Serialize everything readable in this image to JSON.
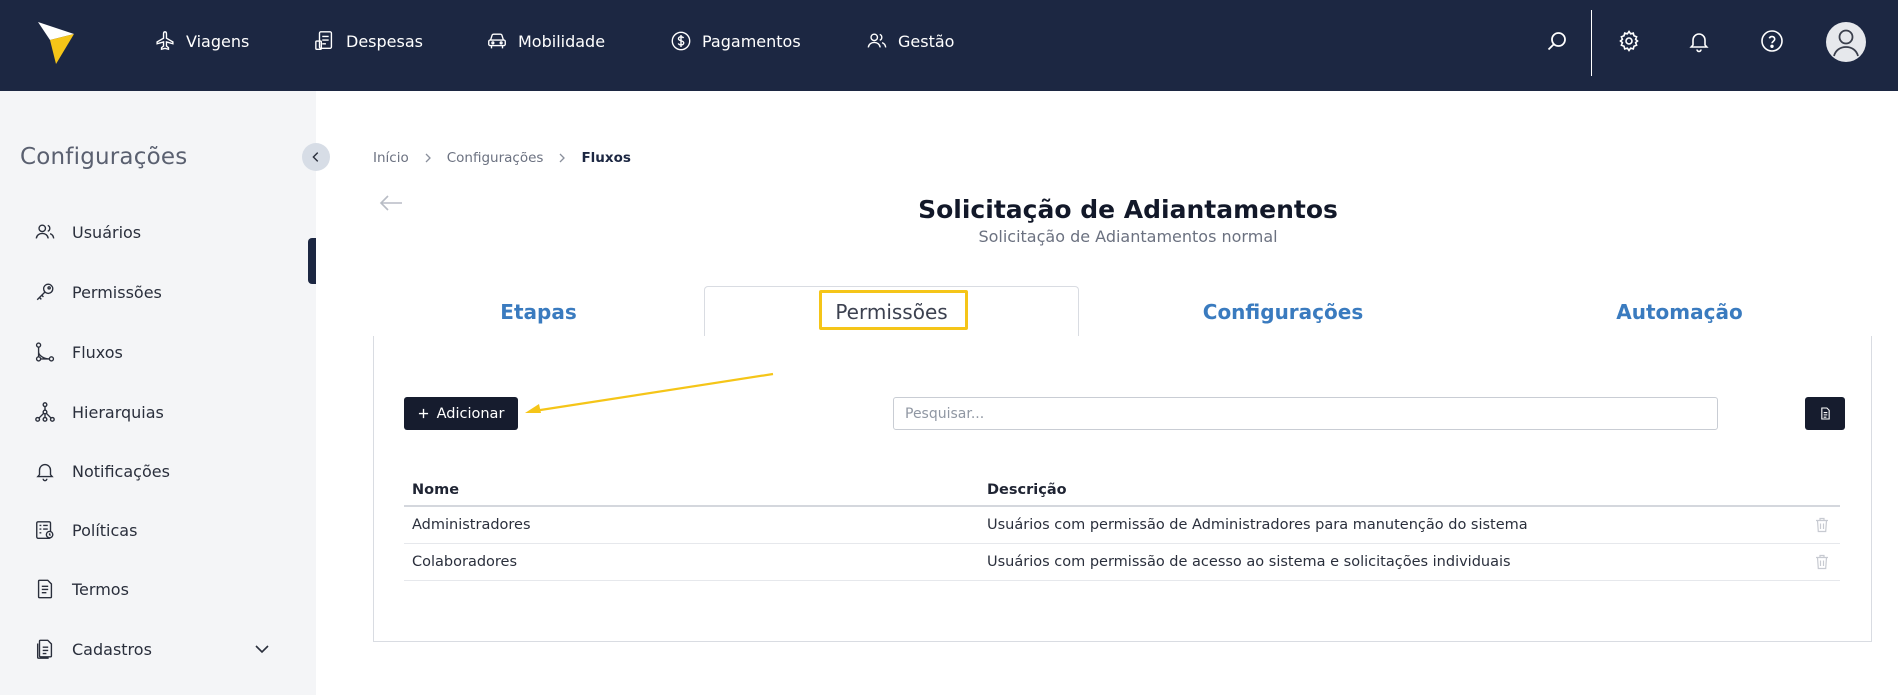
{
  "nav": {
    "items": [
      {
        "label": "Viagens",
        "icon": "plane-icon"
      },
      {
        "label": "Despesas",
        "icon": "receipt-icon"
      },
      {
        "label": "Mobilidade",
        "icon": "car-icon"
      },
      {
        "label": "Pagamentos",
        "icon": "dollar-circle-icon"
      },
      {
        "label": "Gestão",
        "icon": "users-icon"
      }
    ],
    "icons": [
      "search-icon",
      "gear-icon",
      "bell-icon",
      "help-icon",
      "avatar-icon"
    ]
  },
  "sidebar": {
    "title": "Configurações",
    "items": [
      {
        "label": "Usuários",
        "icon": "users-icon"
      },
      {
        "label": "Permissões",
        "icon": "key-icon"
      },
      {
        "label": "Fluxos",
        "icon": "flow-icon"
      },
      {
        "label": "Hierarquias",
        "icon": "hierarchy-icon"
      },
      {
        "label": "Notificações",
        "icon": "bell-icon"
      },
      {
        "label": "Políticas",
        "icon": "policy-icon"
      },
      {
        "label": "Termos",
        "icon": "document-icon"
      },
      {
        "label": "Cadastros",
        "icon": "register-icon"
      }
    ],
    "active": "Fluxos"
  },
  "breadcrumb": {
    "items": [
      "Início",
      "Configurações",
      "Fluxos"
    ]
  },
  "page": {
    "title": "Solicitação de Adiantamentos",
    "subtitle": "Solicitação de Adiantamentos normal"
  },
  "tabs": {
    "items": [
      "Etapas",
      "Permissões",
      "Configurações",
      "Automação"
    ],
    "active": "Permissões"
  },
  "toolbar": {
    "add_label": "Adicionar",
    "search_placeholder": "Pesquisar..."
  },
  "table": {
    "headers": [
      "Nome",
      "Descrição"
    ],
    "rows": [
      {
        "name": "Administradores",
        "description": "Usuários com permissão de Administradores para manutenção do sistema"
      },
      {
        "name": "Colaboradores",
        "description": "Usuários com permissão de acesso ao sistema e solicitações individuais"
      }
    ]
  },
  "colors": {
    "topbar": "#1c2742",
    "accent": "#3a7bbf",
    "highlight": "#f5c518",
    "button": "#161c2e"
  }
}
